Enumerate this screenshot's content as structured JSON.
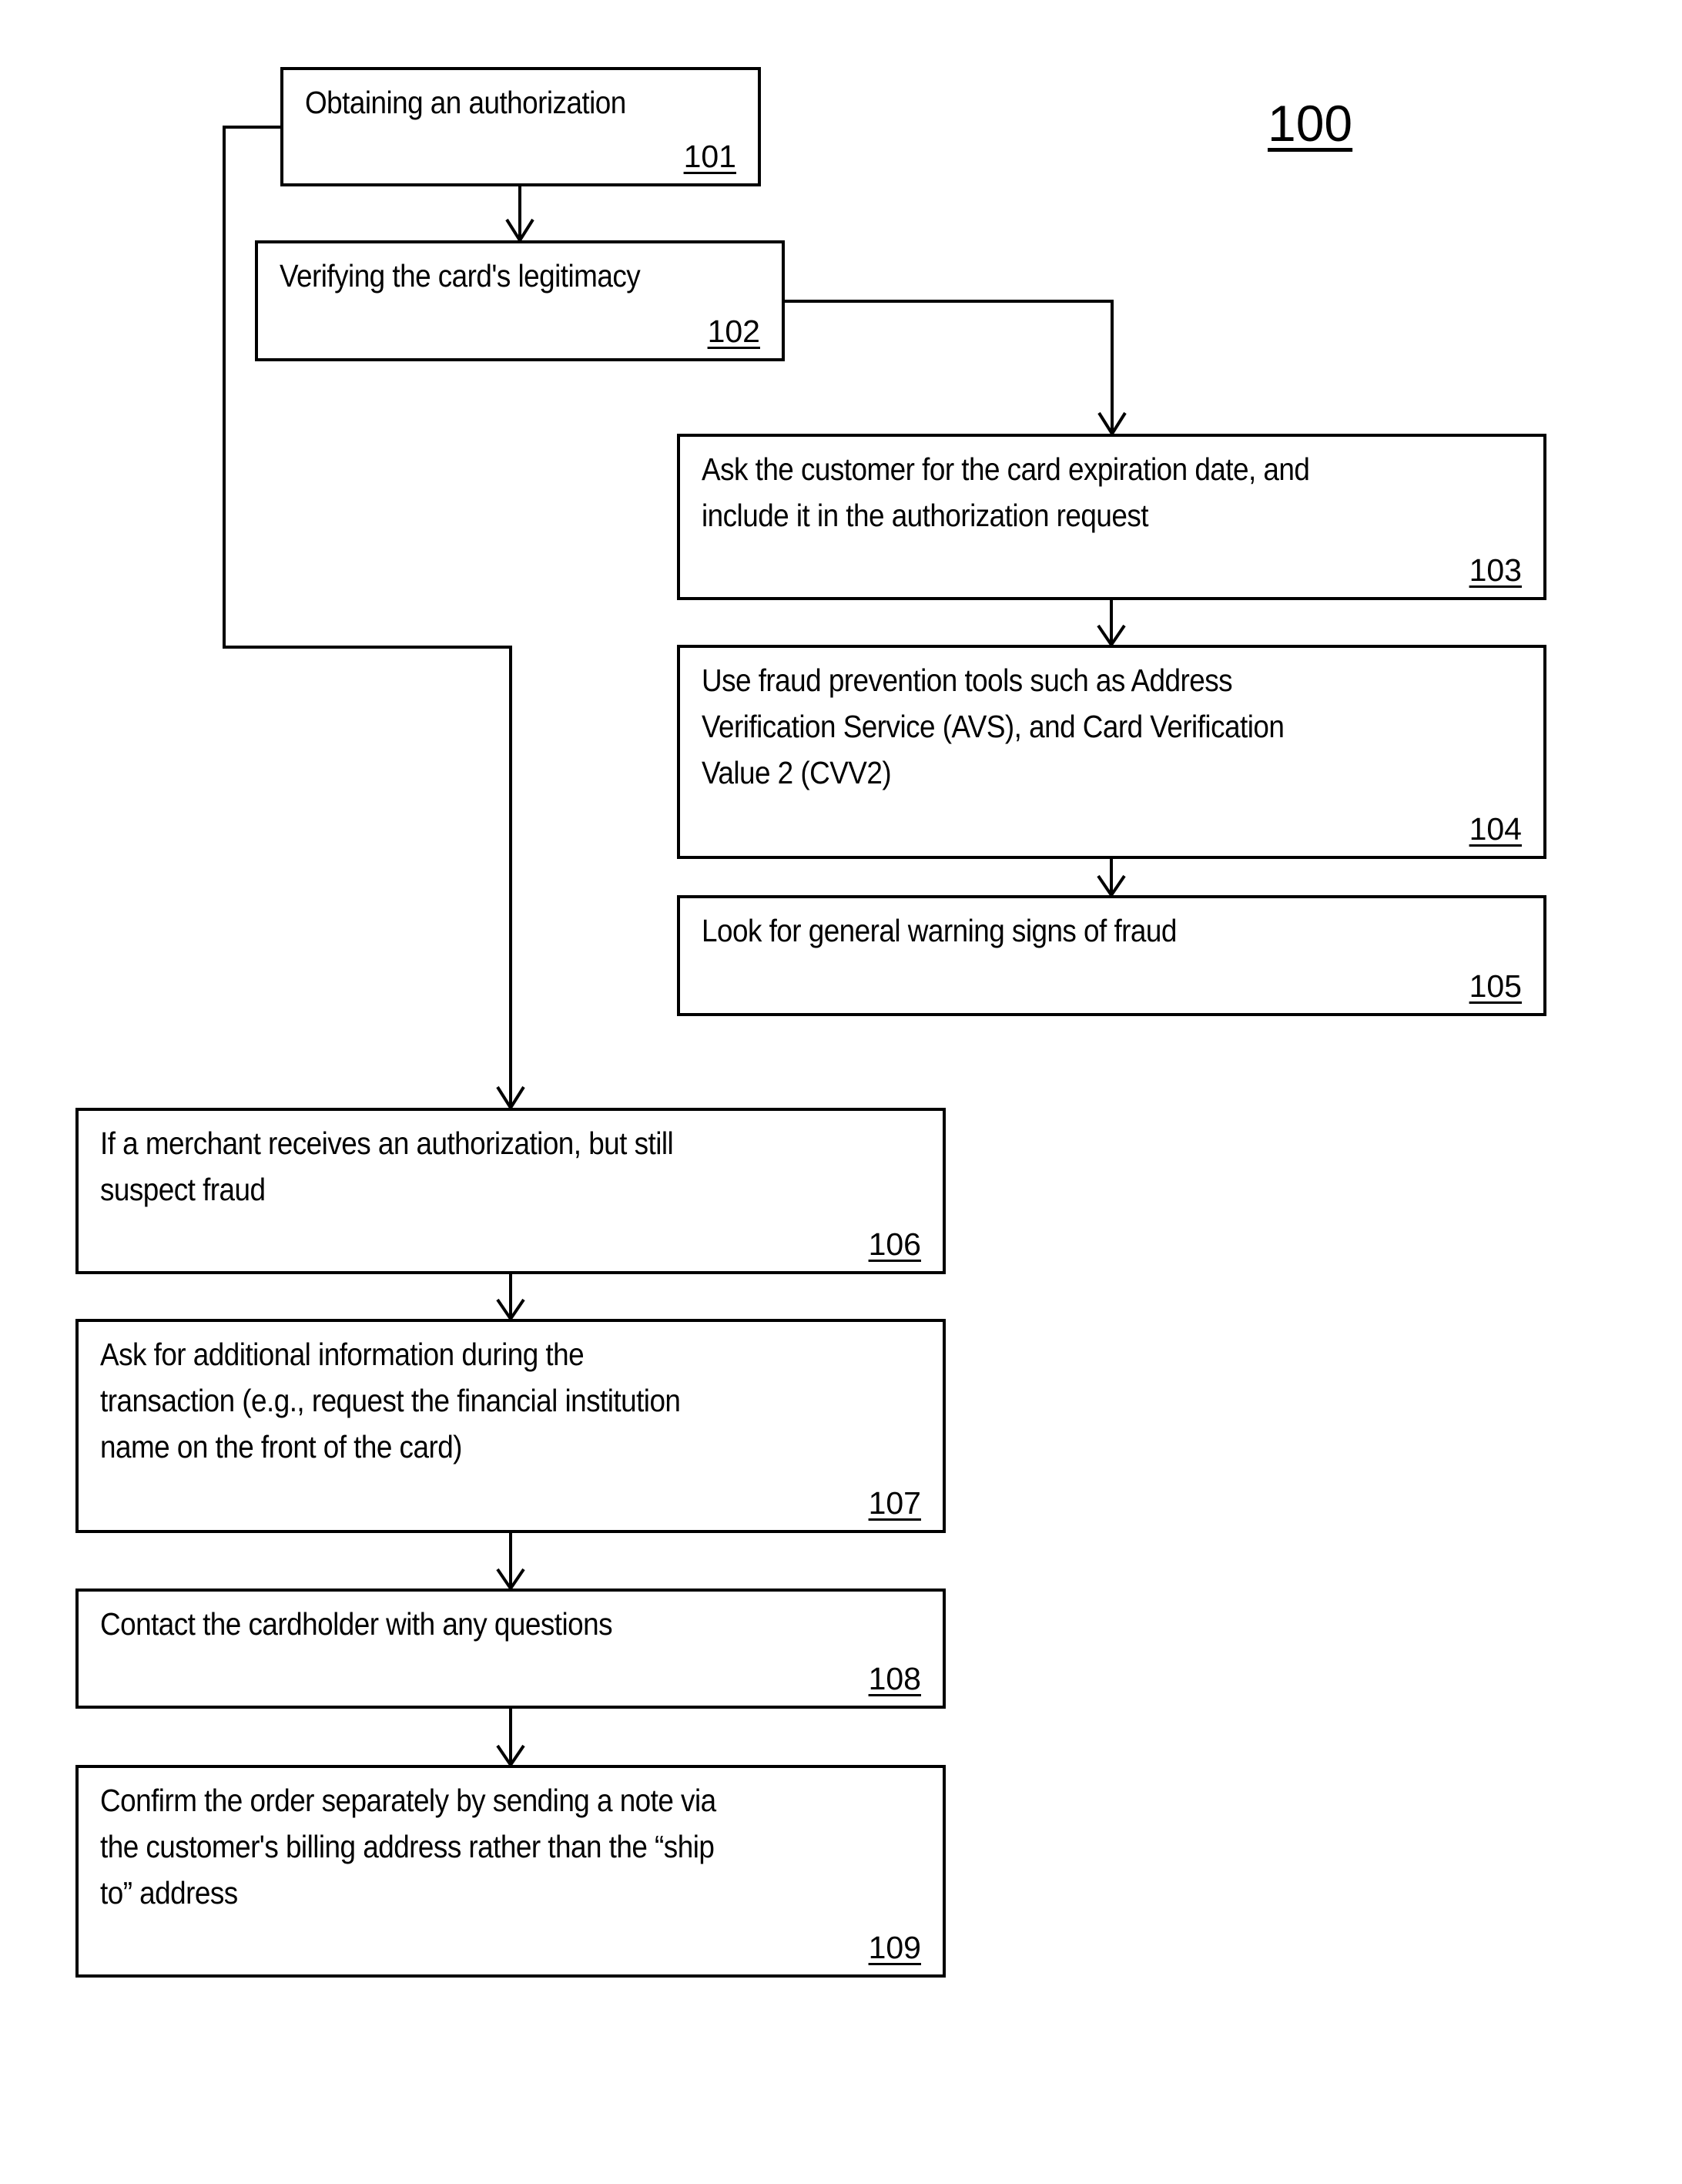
{
  "figure": {
    "label": "100"
  },
  "steps": [
    {
      "id": "101",
      "text": "Obtaining an authorization"
    },
    {
      "id": "102",
      "text": "Verifying the card's legitimacy"
    },
    {
      "id": "103",
      "text": "Ask the customer for the card expiration date, and\ninclude it in the authorization request"
    },
    {
      "id": "104",
      "text": "Use fraud prevention tools such as Address\nVerification Service (AVS), and Card Verification\nValue 2 (CVV2)"
    },
    {
      "id": "105",
      "text": "Look for general warning signs of fraud"
    },
    {
      "id": "106",
      "text": "If a merchant receives an authorization, but still\nsuspect fraud"
    },
    {
      "id": "107",
      "text": "Ask for additional information during the\ntransaction (e.g., request the financial institution\nname on the front of the card)"
    },
    {
      "id": "108",
      "text": "Contact the cardholder with any questions"
    },
    {
      "id": "109",
      "text": "Confirm the order separately by sending a note via\nthe customer's billing address rather than the “ship\nto” address"
    }
  ],
  "connections": [
    {
      "from": "101",
      "to": "102"
    },
    {
      "from": "102",
      "to": "103"
    },
    {
      "from": "101",
      "to": "106"
    },
    {
      "from": "103",
      "to": "104"
    },
    {
      "from": "104",
      "to": "105"
    },
    {
      "from": "106",
      "to": "107"
    },
    {
      "from": "107",
      "to": "108"
    },
    {
      "from": "108",
      "to": "109"
    }
  ]
}
